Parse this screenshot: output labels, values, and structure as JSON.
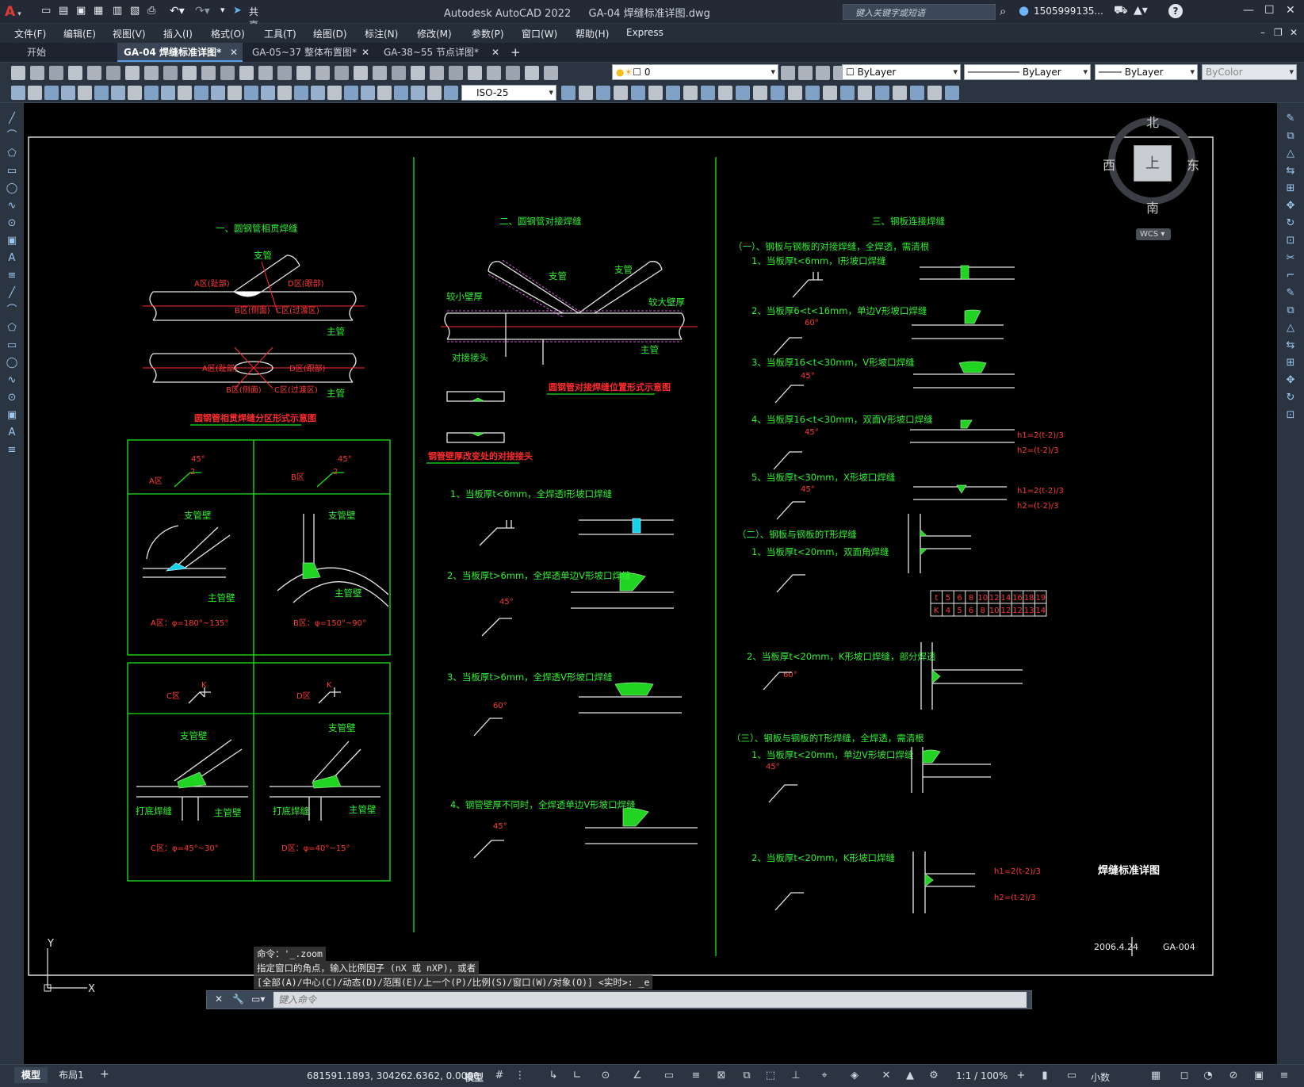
{
  "app": {
    "title": "Autodesk AutoCAD 2022",
    "file": "GA-04 焊缝标准详图.dwg",
    "share_label": "共享",
    "search_placeholder": "键入关键字或短语",
    "user": "1505999135..."
  },
  "menu": [
    "文件(F)",
    "编辑(E)",
    "视图(V)",
    "插入(I)",
    "格式(O)",
    "工具(T)",
    "绘图(D)",
    "标注(N)",
    "修改(M)",
    "参数(P)",
    "窗口(W)",
    "帮助(H)",
    "Express"
  ],
  "tabs": [
    {
      "label": "开始",
      "active": false
    },
    {
      "label": "GA-04 焊缝标准详图*",
      "active": true
    },
    {
      "label": "GA-05~37 整体布置图*",
      "active": false
    },
    {
      "label": "GA-38~55 节点详图*",
      "active": false
    }
  ],
  "toolbar": {
    "layer": "0",
    "color": "ByLayer",
    "linetype": "ByLayer",
    "lineweight": "ByLayer",
    "plotstyle": "ByColor",
    "dimstyle": "ISO-25"
  },
  "viewcube": {
    "north": "北",
    "south": "南",
    "east": "东",
    "west": "西",
    "top": "上",
    "wcs": "WCS"
  },
  "drawing": {
    "s1_title": "一、圆钢管相贯焊缝",
    "s1_labels": [
      "支管",
      "A区(趾部)",
      "D区(跟部)",
      "B区(侧面)",
      "C区(过渡区)",
      "主管",
      "A区(趾部)",
      "D区(跟部)",
      "B区(侧面)",
      "C区(过渡区)",
      "主管"
    ],
    "s1_caption": "圆钢管相贯焊缝分区形式示意图",
    "table_cells": {
      "a_label": "A区",
      "a_angle": "45°",
      "a_size": "2",
      "b_label": "B区",
      "b_angle": "45°",
      "b_size": "2",
      "c_label": "C区",
      "c_k": "K",
      "d_label": "D区",
      "d_k": "K",
      "branch": "支管壁",
      "main": "主管壁",
      "root": "打底焊缝",
      "a_phi": "A区：φ=180°~135°",
      "b_phi": "B区：φ=150°~90°",
      "c_phi": "C区：φ=45°~30°",
      "d_phi": "D区：φ=40°~15°"
    },
    "s2_title": "二、圆钢管对接焊缝",
    "s2_labels": [
      "支管",
      "支管",
      "较小壁厚",
      "较大壁厚",
      "对接接头",
      "主管"
    ],
    "s2_caption": "圆钢管对接焊缝位置形式示意图",
    "s2_caption2": "钢管壁厚改变处的对接接头",
    "s2_items": [
      "1、当板厚t<6mm，全焊透I形坡口焊缝",
      "2、当板厚t>6mm，全焊透单边V形坡口焊缝",
      "3、当板厚t>6mm，全焊透V形坡口焊缝",
      "4、钢管壁厚不同时，全焊透单边V形坡口焊缝"
    ],
    "s3_title": "三、钢板连接焊缝",
    "s3_sub1": "（一）、钢板与钢板的对接焊缝，全焊透，需清根",
    "s3_items1": [
      "1、当板厚t<6mm，I形坡口焊缝",
      "2、当板厚6<t<16mm，单边V形坡口焊缝",
      "3、当板厚16<t<30mm，V形坡口焊缝",
      "4、当板厚16<t<30mm，双面V形坡口焊缝",
      "5、当板厚t<30mm，X形坡口焊缝"
    ],
    "s3_sub2": "（二）、钢板与钢板的T形焊缝",
    "s3_items2": [
      "1、当板厚t<20mm，双面角焊缝",
      "2、当板厚t<20mm，K形坡口焊缝，部分焊透"
    ],
    "s3_sub3": "（三）、钢板与钢板的T形焊缝，全焊透，需清根",
    "s3_items3": [
      "1、当板厚t<20mm，单边V形坡口焊缝",
      "2、当板厚t<20mm，K形坡口焊缝"
    ],
    "h_formulas": [
      "h1=2(t-2)/3",
      "h2=(t-2)/3",
      "h1=2(t-2)/3",
      "h2=(t-2)/3",
      "h1=2(t-2)/3",
      "h2=(t-2)/3"
    ],
    "angles": [
      "45°",
      "60°",
      "45°",
      "60°",
      "45°",
      "45°",
      "45°",
      "60°",
      "45°"
    ],
    "kt_table": {
      "t": [
        "t",
        "5",
        "6",
        "8",
        "10",
        "12",
        "14",
        "16",
        "18",
        "19"
      ],
      "k": [
        "K",
        "4",
        "5",
        "6",
        "8",
        "10",
        "12",
        "12",
        "13",
        "14"
      ]
    },
    "sheet_title": "焊缝标准详图",
    "date": "2006.4.24",
    "sheet_no": "GA-004"
  },
  "command": {
    "line1": "命令：'_.zoom",
    "line2": "指定窗口的角点，输入比例因子 (nX 或 nXP)，或者",
    "line3": "[全部(A)/中心(C)/动态(D)/范围(E)/上一个(P)/比例(S)/窗口(W)/对象(O)] <实时>: _e",
    "placeholder": "键入命令"
  },
  "status": {
    "model_tab": "模型",
    "layout_tab": "布局1",
    "coords": "681591.1893, 304262.6362, 0.0000",
    "space": "模型",
    "scale": "1:1 / 100%",
    "units": "小数"
  },
  "ucs": {
    "y": "Y",
    "x": "X"
  }
}
